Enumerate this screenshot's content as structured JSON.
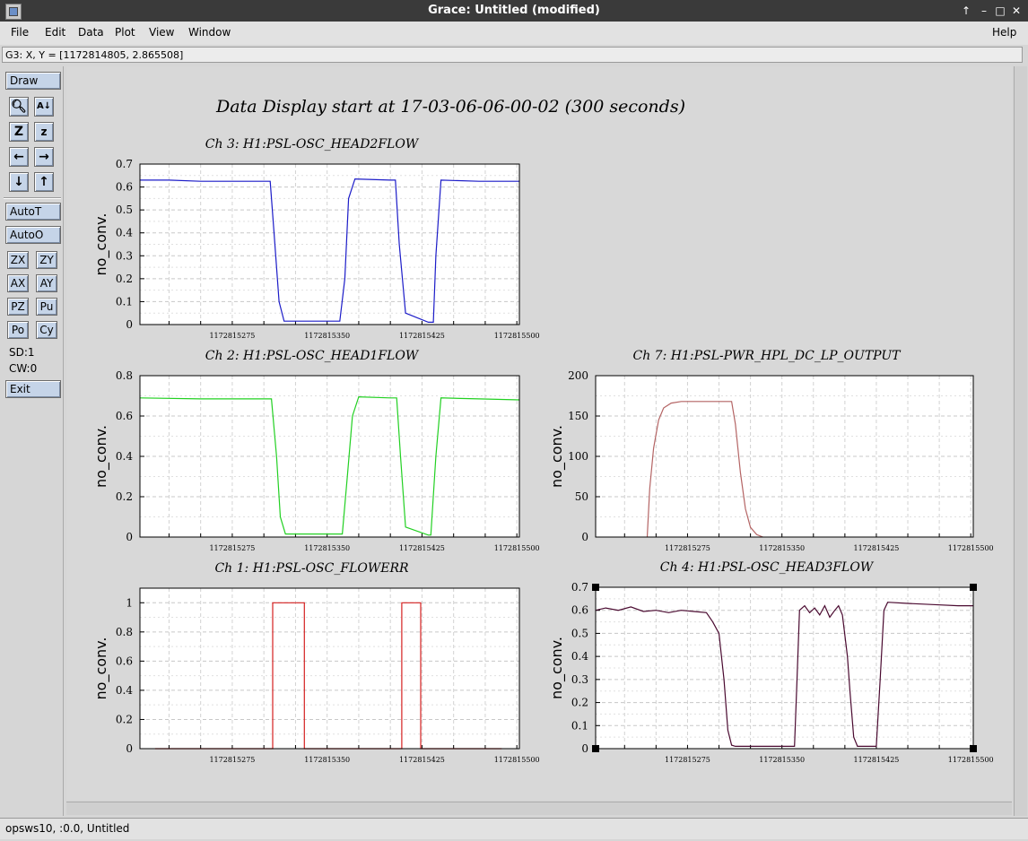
{
  "window": {
    "title": "Grace: Untitled (modified)"
  },
  "menu": {
    "items": [
      "File",
      "Edit",
      "Data",
      "Plot",
      "View",
      "Window"
    ],
    "help": "Help"
  },
  "status": {
    "coords": "G3: X, Y = [1172814805, 2.865508]"
  },
  "toolbox": {
    "draw": "Draw",
    "autot": "AutoT",
    "autoo": "AutoO",
    "zx": "ZX",
    "zy": "ZY",
    "ax": "AX",
    "ay": "AY",
    "pz": "PZ",
    "pu": "Pu",
    "po": "Po",
    "cy": "Cy",
    "sd": "SD:1",
    "cw": "CW:0",
    "exit": "Exit"
  },
  "footer": {
    "text": "opsws10, :0.0, Untitled"
  },
  "page_title": "Data Display start at 17-03-06-06-00-02 (300 seconds)",
  "colors": {
    "ch3": "#1c1cc8",
    "ch2": "#22d022",
    "ch1": "#d42020",
    "ch7": "#b46464",
    "ch4": "#4a0a30"
  },
  "chart_data": [
    {
      "type": "line",
      "title": "Ch 3: H1:PSL-OSC_HEAD2FLOW",
      "ylabel": "no_conv.",
      "xlim": [
        1172815202,
        1172815502
      ],
      "ylim": [
        0,
        0.7
      ],
      "yticks": [
        "0",
        "0.1",
        "0.2",
        "0.3",
        "0.4",
        "0.5",
        "0.6",
        "0.7"
      ],
      "xticks": [
        "1172815275",
        "1172815350",
        "1172815425",
        "1172815500"
      ],
      "grid": true,
      "series": [
        {
          "color": "#1c1cc8",
          "x": [
            1172815202,
            1172815225,
            1172815250,
            1172815305,
            1172815308,
            1172815312,
            1172815316,
            1172815330,
            1172815360,
            1172815364,
            1172815367,
            1172815372,
            1172815400,
            1172815404,
            1172815407,
            1172815412,
            1172815430,
            1172815434,
            1172815436,
            1172815440,
            1172815470,
            1172815502
          ],
          "y": [
            0.63,
            0.63,
            0.625,
            0.625,
            0.4,
            0.1,
            0.015,
            0.015,
            0.015,
            0.2,
            0.55,
            0.635,
            0.63,
            0.63,
            0.35,
            0.05,
            0.01,
            0.01,
            0.3,
            0.63,
            0.625,
            0.625
          ]
        }
      ]
    },
    {
      "type": "line",
      "title": "Ch 2: H1:PSL-OSC_HEAD1FLOW",
      "ylabel": "no_conv.",
      "xlim": [
        1172815202,
        1172815502
      ],
      "ylim": [
        0,
        0.8
      ],
      "yticks": [
        "0",
        "0.2",
        "0.4",
        "0.6",
        "0.8"
      ],
      "xticks": [
        "1172815275",
        "1172815350",
        "1172815425",
        "1172815500"
      ],
      "grid": true,
      "series": [
        {
          "color": "#22d022",
          "x": [
            1172815202,
            1172815250,
            1172815306,
            1172815310,
            1172815313,
            1172815317,
            1172815330,
            1172815362,
            1172815366,
            1172815370,
            1172815375,
            1172815400,
            1172815405,
            1172815408,
            1172815412,
            1172815430,
            1172815432,
            1172815436,
            1172815440,
            1172815470,
            1172815502
          ],
          "y": [
            0.69,
            0.685,
            0.685,
            0.4,
            0.1,
            0.015,
            0.015,
            0.015,
            0.3,
            0.6,
            0.695,
            0.69,
            0.69,
            0.4,
            0.05,
            0.01,
            0.01,
            0.4,
            0.69,
            0.685,
            0.68
          ]
        }
      ]
    },
    {
      "type": "line",
      "title": "Ch 7: H1:PSL-PWR_HPL_DC_LP_OUTPUT",
      "ylabel": "no_conv.",
      "xlim": [
        1172815202,
        1172815502
      ],
      "ylim": [
        0,
        200
      ],
      "yticks": [
        "0",
        "50",
        "100",
        "150",
        "200"
      ],
      "xticks": [
        "1172815275",
        "1172815350",
        "1172815425",
        "1172815500"
      ],
      "grid": true,
      "series": [
        {
          "color": "#b46464",
          "x": [
            1172815243,
            1172815245,
            1172815248,
            1172815252,
            1172815256,
            1172815262,
            1172815270,
            1172815290,
            1172815310,
            1172815313,
            1172815317,
            1172815321,
            1172815325,
            1172815330,
            1172815335
          ],
          "y": [
            0,
            60,
            110,
            145,
            160,
            166,
            168,
            168,
            168,
            140,
            80,
            35,
            12,
            3,
            0
          ]
        }
      ]
    },
    {
      "type": "line",
      "title": "Ch 1: H1:PSL-OSC_FLOWERR",
      "ylabel": "no_conv.",
      "xlim": [
        1172815202,
        1172815502
      ],
      "ylim": [
        0,
        1.1
      ],
      "yticks": [
        "0",
        "0.2",
        "0.4",
        "0.6",
        "0.8",
        "1"
      ],
      "xticks": [
        "1172815275",
        "1172815350",
        "1172815425",
        "1172815500"
      ],
      "grid": true,
      "series": [
        {
          "color": "#d42020",
          "x": [
            1172815214,
            1172815307,
            1172815307,
            1172815332,
            1172815332,
            1172815409,
            1172815409,
            1172815424,
            1172815424,
            1172815488
          ],
          "y": [
            0,
            0,
            1,
            1,
            0,
            0,
            1,
            1,
            0,
            0
          ]
        }
      ]
    },
    {
      "type": "line",
      "title": "Ch 4: H1:PSL-OSC_HEAD3FLOW",
      "ylabel": "no_conv.",
      "xlim": [
        1172815202,
        1172815502
      ],
      "ylim": [
        0,
        0.7
      ],
      "yticks": [
        "0",
        "0.1",
        "0.2",
        "0.3",
        "0.4",
        "0.5",
        "0.6",
        "0.7"
      ],
      "xticks": [
        "1172815275",
        "1172815350",
        "1172815425",
        "1172815500"
      ],
      "grid": true,
      "series": [
        {
          "color": "#4a0a30",
          "x": [
            1172815202,
            1172815210,
            1172815220,
            1172815230,
            1172815240,
            1172815250,
            1172815260,
            1172815270,
            1172815280,
            1172815290,
            1172815295,
            1172815300,
            1172815304,
            1172815307,
            1172815310,
            1172815313,
            1172815330,
            1172815360,
            1172815362,
            1172815364,
            1172815368,
            1172815372,
            1172815376,
            1172815380,
            1172815384,
            1172815388,
            1172815392,
            1172815395,
            1172815398,
            1172815402,
            1172815404,
            1172815407,
            1172815410,
            1172815425,
            1172815428,
            1172815431,
            1172815434,
            1172815450,
            1172815470,
            1172815490,
            1172815502
          ],
          "y": [
            0.6,
            0.61,
            0.6,
            0.615,
            0.595,
            0.6,
            0.59,
            0.6,
            0.595,
            0.59,
            0.55,
            0.5,
            0.3,
            0.08,
            0.015,
            0.01,
            0.01,
            0.01,
            0.3,
            0.6,
            0.62,
            0.59,
            0.61,
            0.58,
            0.62,
            0.57,
            0.6,
            0.62,
            0.58,
            0.4,
            0.25,
            0.05,
            0.01,
            0.01,
            0.3,
            0.6,
            0.635,
            0.63,
            0.625,
            0.62,
            0.62
          ]
        }
      ]
    }
  ]
}
